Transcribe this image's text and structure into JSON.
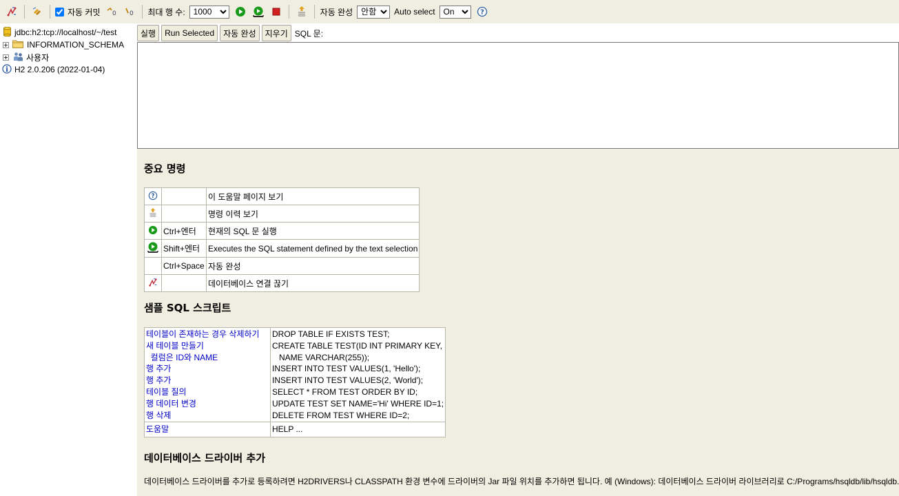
{
  "toolbar": {
    "auto_commit_label": "자동 커밋",
    "max_rows_label": "최대 행 수:",
    "max_rows_value": "1000",
    "max_rows_options": [
      "1000"
    ],
    "autocomplete_label": "자동 완성",
    "autocomplete_value": "안함",
    "autoselect_label": "Auto select",
    "autoselect_value": "On"
  },
  "tree": {
    "connection": "jdbc:h2:tcp://localhost/~/test",
    "schema": "INFORMATION_SCHEMA",
    "users": "사용자",
    "version": "H2 2.0.206 (2022-01-04)"
  },
  "query": {
    "run_label": "실행",
    "run_selected_label": "Run Selected",
    "autocomplete_label": "자동 완성",
    "clear_label": "지우기",
    "sql_label": "SQL 문:"
  },
  "help": {
    "important_title": "중요 명령",
    "commands": [
      {
        "icon": "help-icon",
        "key": "",
        "desc": "이 도움말 페이지 보기"
      },
      {
        "icon": "history-icon",
        "key": "",
        "desc": "명령 이력 보기"
      },
      {
        "icon": "run-icon",
        "key": "Ctrl+엔터",
        "desc": "현재의 SQL 문 실행"
      },
      {
        "icon": "run-selected-icon",
        "key": "Shift+엔터",
        "desc": "Executes the SQL statement defined by the text selection"
      },
      {
        "icon": "",
        "key": "Ctrl+Space",
        "desc": "자동 완성"
      },
      {
        "icon": "disconnect-icon",
        "key": "",
        "desc": "데이터베이스 연결 끊기"
      }
    ],
    "sample_title": "샘플 SQL 스크립트",
    "samples": [
      {
        "label": "테이블이 존재하는 경우 삭제하기",
        "sql": "DROP TABLE IF EXISTS TEST;"
      },
      {
        "label": "새 테이블 만들기",
        "sql": "CREATE TABLE TEST(ID INT PRIMARY KEY,"
      },
      {
        "label": "  컬럼은 ID와 NAME",
        "sql": "   NAME VARCHAR(255));"
      },
      {
        "label": "행 추가",
        "sql": "INSERT INTO TEST VALUES(1, 'Hello');"
      },
      {
        "label": "행 추가",
        "sql": "INSERT INTO TEST VALUES(2, 'World');"
      },
      {
        "label": "테이블 질의",
        "sql": "SELECT * FROM TEST ORDER BY ID;"
      },
      {
        "label": "행 데이터 변경",
        "sql": "UPDATE TEST SET NAME='Hi' WHERE ID=1;"
      },
      {
        "label": "행 삭제",
        "sql": "DELETE FROM TEST WHERE ID=2;"
      }
    ],
    "help_row": {
      "label": "도움말",
      "sql": "HELP ..."
    },
    "driver_title": "데이터베이스 드라이버 추가",
    "driver_note": "데이터베이스 드라이버를 추가로 등록하려면 H2DRIVERS나 CLASSPATH 환경 변수에 드라이버의 Jar 파일 위치를 추가하면 됩니다. 예 (Windows): 데이터베이스 드라이버 라이브러리로 C:/Programs/hsqldb/lib/hsqldb.jar"
  },
  "colors": {
    "panel_bg": "#f0eee0",
    "link": "#0000c8",
    "run_green": "#1a9a1a",
    "stop_red": "#d42020"
  }
}
